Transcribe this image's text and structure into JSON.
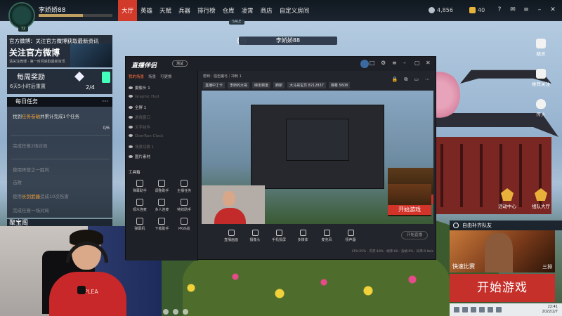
{
  "user": {
    "name": "李娇娇88",
    "level": "72"
  },
  "nav": {
    "items": [
      "大厅",
      "英雄",
      "天赋",
      "兵器",
      "排行榜",
      "仓库",
      "凌霄",
      "商店",
      "自定义房间"
    ],
    "active_index": 0,
    "badge": "SALE"
  },
  "currency": {
    "silver": "4,856",
    "gold": "40"
  },
  "sys_icons": [
    "help-icon",
    "mail-icon",
    "menu-icon",
    "minimize-icon",
    "close-icon"
  ],
  "weibo": {
    "line1": "官方微博：关注官方微博获取最新资讯",
    "line2": "关注官方微博",
    "line3": "请关注微博 · 第一时间获取最新资讯"
  },
  "weekly": {
    "title": "每周奖励",
    "reset": "6天5小时后重置",
    "progress": "2/4"
  },
  "daily": {
    "title": "每日任务",
    "more": "···",
    "task1_pre": "找到",
    "task1_hl": "任务卷轴",
    "task1_post": "并累计完成1个任务",
    "task1_count": "0/6",
    "task2": "完成任意2场对局",
    "task3": "使用阵营之一胜利",
    "task4": "击败",
    "task5_pre": "使用",
    "task5_hl": "长剑武器",
    "task5_post": "造成10次伤害",
    "task6": "完成任意一场对局"
  },
  "subtitle": "聚宝阁",
  "streamer": {
    "name": "李娇娇88"
  },
  "obs": {
    "title": "直播伴侣",
    "badge": "测试",
    "tabs": [
      "我的场景",
      "场景",
      "可更换"
    ],
    "sources": [
      {
        "name": "摄像头 1",
        "dim": false
      },
      {
        "name": "Graphic Hud",
        "dim": true
      },
      {
        "name": "全屏 1",
        "dim": false
      },
      {
        "name": "游戏窗口",
        "dim": true
      },
      {
        "name": "文字挂件",
        "dim": true
      },
      {
        "name": "OverRun Clock",
        "dim": true
      },
      {
        "name": "场景切换 1",
        "dim": true
      },
      {
        "name": "图片素材",
        "dim": false
      }
    ],
    "tools_title": "工具箱",
    "tools": [
      "弹幕助手",
      "调整助手",
      "主播任务",
      "观众连麦",
      "多人连麦",
      "特效助手",
      "弹幕机",
      "下载助手",
      "PK对战",
      "直播回放",
      "礼物展示",
      "设置"
    ],
    "info1": "帮到：强击魔弓｜冲刺 1",
    "info_chips": [
      "直播中丁卡",
      "李娇的大哥",
      "绑定频道",
      "刷新",
      "大马哥宝贝 8212837",
      "弹幕 5608"
    ],
    "bottom_btns": [
      "直播画面",
      "摄像头",
      "手机投屏",
      "多媒体",
      "麦克风",
      "扬声器"
    ],
    "start_live": "开始直播",
    "status": "CPU:25%  ·  内存:18%  ·  帧率:60  ·  丢帧:0%  ·  码率:0 kb/s"
  },
  "right_icons": [
    {
      "icon": "headset-icon",
      "label": "精灵"
    },
    {
      "icon": "camera-icon",
      "label": "推荐关注"
    },
    {
      "icon": "fire-icon",
      "label": "传火"
    }
  ],
  "activity": {
    "center": "活动中心",
    "team_hall": "组队大厅"
  },
  "mini_start": "开始游戏",
  "team_label": "自由补齐队友",
  "match": {
    "left": "快速比赛",
    "right": "三排"
  },
  "start_game": "开始游戏",
  "clock": {
    "time": "22:41",
    "date": "2022/2/7"
  }
}
